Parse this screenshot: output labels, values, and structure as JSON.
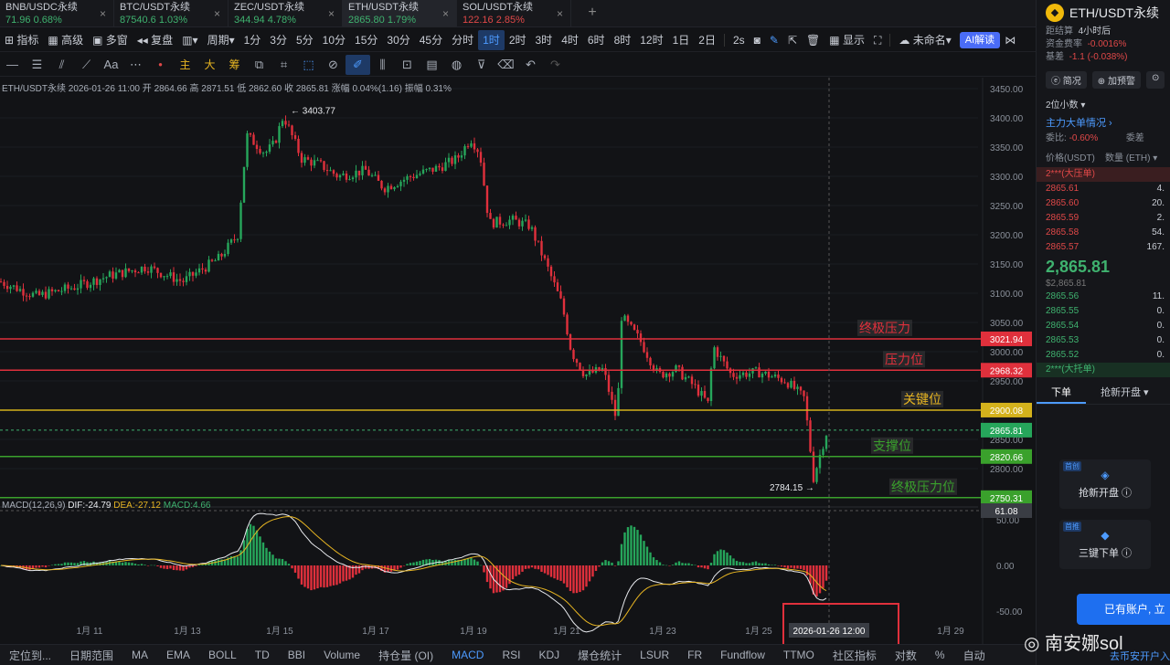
{
  "tabs": [
    {
      "name": "BNB/USDC永续",
      "price": "71.96",
      "change": "0.68%",
      "dir": "up"
    },
    {
      "name": "BTC/USDT永续",
      "price": "87540.6",
      "change": "1.03%",
      "dir": "up"
    },
    {
      "name": "ZEC/USDT永续",
      "price": "344.94",
      "change": "4.78%",
      "dir": "up"
    },
    {
      "name": "ETH/USDT永续",
      "price": "2865.80",
      "change": "1.79%",
      "dir": "up",
      "active": true
    },
    {
      "name": "SOL/USDT永续",
      "price": "122.16",
      "change": "2.85%",
      "dir": "down"
    }
  ],
  "toolbar": {
    "indicators": "指标",
    "advanced": "高级",
    "multi_window": "多窗",
    "replay": "复盘",
    "period": "周期",
    "intervals": [
      "1分",
      "3分",
      "5分",
      "10分",
      "15分",
      "30分",
      "45分",
      "分时",
      "1时",
      "2时",
      "3时",
      "4时",
      "6时",
      "8时",
      "12时",
      "1日",
      "2日"
    ],
    "selected_interval": "1时",
    "refresh": "2s",
    "display": "显示",
    "unnamed": "未命名",
    "ai": "AI解读"
  },
  "drawtools": {
    "text": "Aa",
    "zhu": "主",
    "da": "大",
    "chou": "筹"
  },
  "ohlc": {
    "symbol": "ETH/USDT永续",
    "time": "2026-01-26 11:00",
    "open_label": "开",
    "open": "2864.66",
    "high_label": "高",
    "high": "2871.51",
    "low_label": "低",
    "low": "2862.60",
    "close_label": "收",
    "close": "2865.81",
    "change_label": "涨幅",
    "change": "0.04%(1.16)",
    "amp_label": "振幅",
    "amp": "0.31%"
  },
  "levels": [
    {
      "label": "终极压力",
      "value": 3021.94,
      "value_text": "3021.94",
      "color": "#e0303c"
    },
    {
      "label": "压力位",
      "value": 2968.32,
      "value_text": "2968.32",
      "color": "#e0303c"
    },
    {
      "label": "关键位",
      "value": 2900.08,
      "value_text": "2900.08",
      "color": "#d4b21c"
    },
    {
      "label": "支撑位",
      "value": 2820.66,
      "value_text": "2820.66",
      "color": "#3aa12c"
    },
    {
      "label": "终极压力位",
      "value": 2750.31,
      "value_text": "2750.31",
      "color": "#3aa12c"
    }
  ],
  "price_marks": {
    "high": "3403.77",
    "low": "2784.15",
    "last": "2865.81"
  },
  "macd": {
    "params": "MACD(12,26,9)",
    "dif_label": "DIF:",
    "dif": "-24.79",
    "dea_label": "DEA:",
    "dea": "-27.12",
    "macd_label": "MACD:",
    "macd": "4.66",
    "cursor_value": "61.08"
  },
  "crosshair_time": "2026-01-26 12:00",
  "chart_data": {
    "type": "candlestick",
    "price_axis": [
      3450,
      3400,
      3350,
      3300,
      3250,
      3200,
      3150,
      3100,
      3050,
      3000,
      2950,
      2900,
      2850,
      2800,
      2750
    ],
    "ylim": [
      2750,
      3450
    ],
    "macd_axis": [
      50,
      0,
      -50
    ],
    "date_labels": [
      "1月 11",
      "1月 13",
      "1月 15",
      "1月 17",
      "1月 19",
      "1月 21",
      "1月 23",
      "1月 25",
      "1月 29"
    ],
    "path": [
      [
        0,
        3120
      ],
      [
        40,
        3095
      ],
      [
        80,
        3110
      ],
      [
        120,
        3130
      ],
      [
        160,
        3145
      ],
      [
        200,
        3120
      ],
      [
        240,
        3160
      ],
      [
        260,
        3200
      ],
      [
        270,
        3370
      ],
      [
        290,
        3340
      ],
      [
        300,
        3355
      ],
      [
        310,
        3403.77
      ],
      [
        330,
        3330
      ],
      [
        350,
        3320
      ],
      [
        370,
        3300
      ],
      [
        400,
        3310
      ],
      [
        420,
        3280
      ],
      [
        450,
        3300
      ],
      [
        480,
        3315
      ],
      [
        500,
        3330
      ],
      [
        515,
        3365
      ],
      [
        525,
        3340
      ],
      [
        535,
        3220
      ],
      [
        560,
        3225
      ],
      [
        580,
        3215
      ],
      [
        600,
        3140
      ],
      [
        615,
        3080
      ],
      [
        625,
        3000
      ],
      [
        640,
        2960
      ],
      [
        660,
        2970
      ],
      [
        675,
        2880
      ],
      [
        680,
        3060
      ],
      [
        700,
        3020
      ],
      [
        720,
        2960
      ],
      [
        740,
        2970
      ],
      [
        760,
        2940
      ],
      [
        775,
        2910
      ],
      [
        780,
        3010
      ],
      [
        800,
        2960
      ],
      [
        830,
        2965
      ],
      [
        860,
        2950
      ],
      [
        880,
        2920
      ],
      [
        890,
        2784.15
      ],
      [
        900,
        2840
      ],
      [
        905,
        2865.81
      ]
    ]
  },
  "bottom": [
    "定位到...",
    "日期范围",
    "MA",
    "EMA",
    "BOLL",
    "TD",
    "BBI",
    "Volume",
    "持仓量 (OI)",
    "MACD",
    "RSI",
    "KDJ",
    "爆仓统计",
    "LSUR",
    "FR",
    "Fundflow",
    "TTMO",
    "社区指标",
    "对数",
    "%",
    "自动"
  ],
  "panel": {
    "symbol": "ETH/USDT永续",
    "settle_label": "距结算",
    "settle": "4小时后",
    "funding_label": "资金费率",
    "funding": "-0.0016%",
    "basis_label": "基差",
    "basis": "-1.1 (-0.038%)",
    "btn_info": "简况",
    "btn_alert": "加预警",
    "precision": "2位小数",
    "main_force": "主力大单情况",
    "ratio_label": "委比:",
    "ratio": "-0.60%",
    "ratio2": "委差",
    "col_price": "价格(USDT)",
    "col_qty": "数量 (ETH)",
    "big_ask": "2***(大压单)",
    "asks": [
      [
        "2865.61",
        "4."
      ],
      [
        "2865.60",
        "20."
      ],
      [
        "2865.59",
        "2."
      ],
      [
        "2865.58",
        "54."
      ],
      [
        "2865.57",
        "167."
      ]
    ],
    "last": "2,865.81",
    "last_sub": "$2,865.81",
    "bids": [
      [
        "2865.56",
        "11."
      ],
      [
        "2865.55",
        "0."
      ],
      [
        "2865.54",
        "0."
      ],
      [
        "2865.53",
        "0."
      ],
      [
        "2865.52",
        "0."
      ]
    ],
    "big_bid": "2***(大托单)",
    "tab_order": "下单",
    "tab_grab": "抢新开盘",
    "card1_tag": "首创",
    "card1": "抢新开盘",
    "card2_tag": "首推",
    "card2": "三键下单",
    "account_btn": "已有账户, 立",
    "footer": "去币安开户入"
  },
  "watermark": "南安娜sol"
}
